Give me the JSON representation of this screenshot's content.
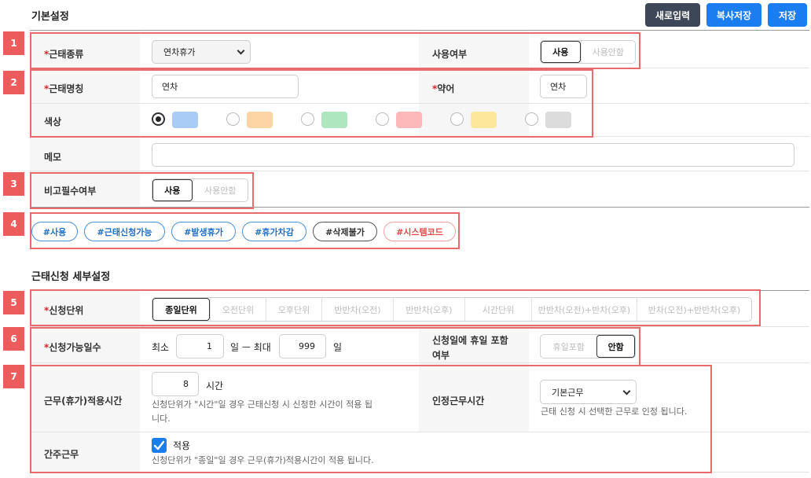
{
  "header": {
    "title": "기본설정",
    "buttons": {
      "new": "새로입력",
      "copy_save": "복사저장",
      "save": "저장"
    }
  },
  "badges": [
    "1",
    "2",
    "3",
    "4",
    "5",
    "6",
    "7"
  ],
  "basic": {
    "type_label": "근태종류",
    "type_value": "연차휴가",
    "use_label": "사용여부",
    "use_options": [
      "사용",
      "사용안함"
    ],
    "name_label": "근태명칭",
    "name_value": "연차",
    "abbr_label": "약어",
    "abbr_value": "연차",
    "color_label": "색상",
    "colors": [
      "#a8ccf6",
      "#fdd5a2",
      "#ade6bf",
      "#fdb9b9",
      "#fde79a",
      "#dcdcdc"
    ],
    "memo_label": "메모",
    "memo_value": "",
    "remark_label": "비고필수여부",
    "remark_options": [
      "사용",
      "사용안함"
    ]
  },
  "tags": [
    "#사용",
    "#근태신청가능",
    "#발생휴가",
    "#휴가차감",
    "#삭제불가",
    "#시스템코드"
  ],
  "apply": {
    "title": "근태신청 세부설정",
    "unit_label": "신청단위",
    "unit_options": [
      "종일단위",
      "오전단위",
      "오후단위",
      "반반차(오전)",
      "반반차(오후)",
      "시간단위",
      "반반차(오전)+반차(오후)",
      "반차(오전)+반반차(오후)"
    ],
    "days_label": "신청가능일수",
    "min_label": "최소",
    "min_value": "1",
    "day_max_label": "일 ㅡ 최대",
    "max_value": "999",
    "day_label": "일",
    "holiday_label_1": "신청일에 휴일 포함",
    "holiday_label_2": "여부",
    "holiday_options": [
      "휴일포함",
      "안함"
    ],
    "work_time_label": "근무(휴가)적용시간",
    "work_time_value": "8",
    "hour_label": "시간",
    "work_time_help_1": "신청단위가 \"시간\"일 경우 근태신청 시 신청한 시간이 적용 됩",
    "work_time_help_2": "니다.",
    "approve_label": "인정근무시간",
    "approve_value": "기본근무",
    "approve_help": "근태 신청 시 선택한 근무로 인정 됩니다.",
    "deem_label": "간주근무",
    "deem_check_label": "적용",
    "deem_help": "신청단위가 \"종일\"일 경우 근무(휴가)적용시간이 적용 됩니다."
  }
}
